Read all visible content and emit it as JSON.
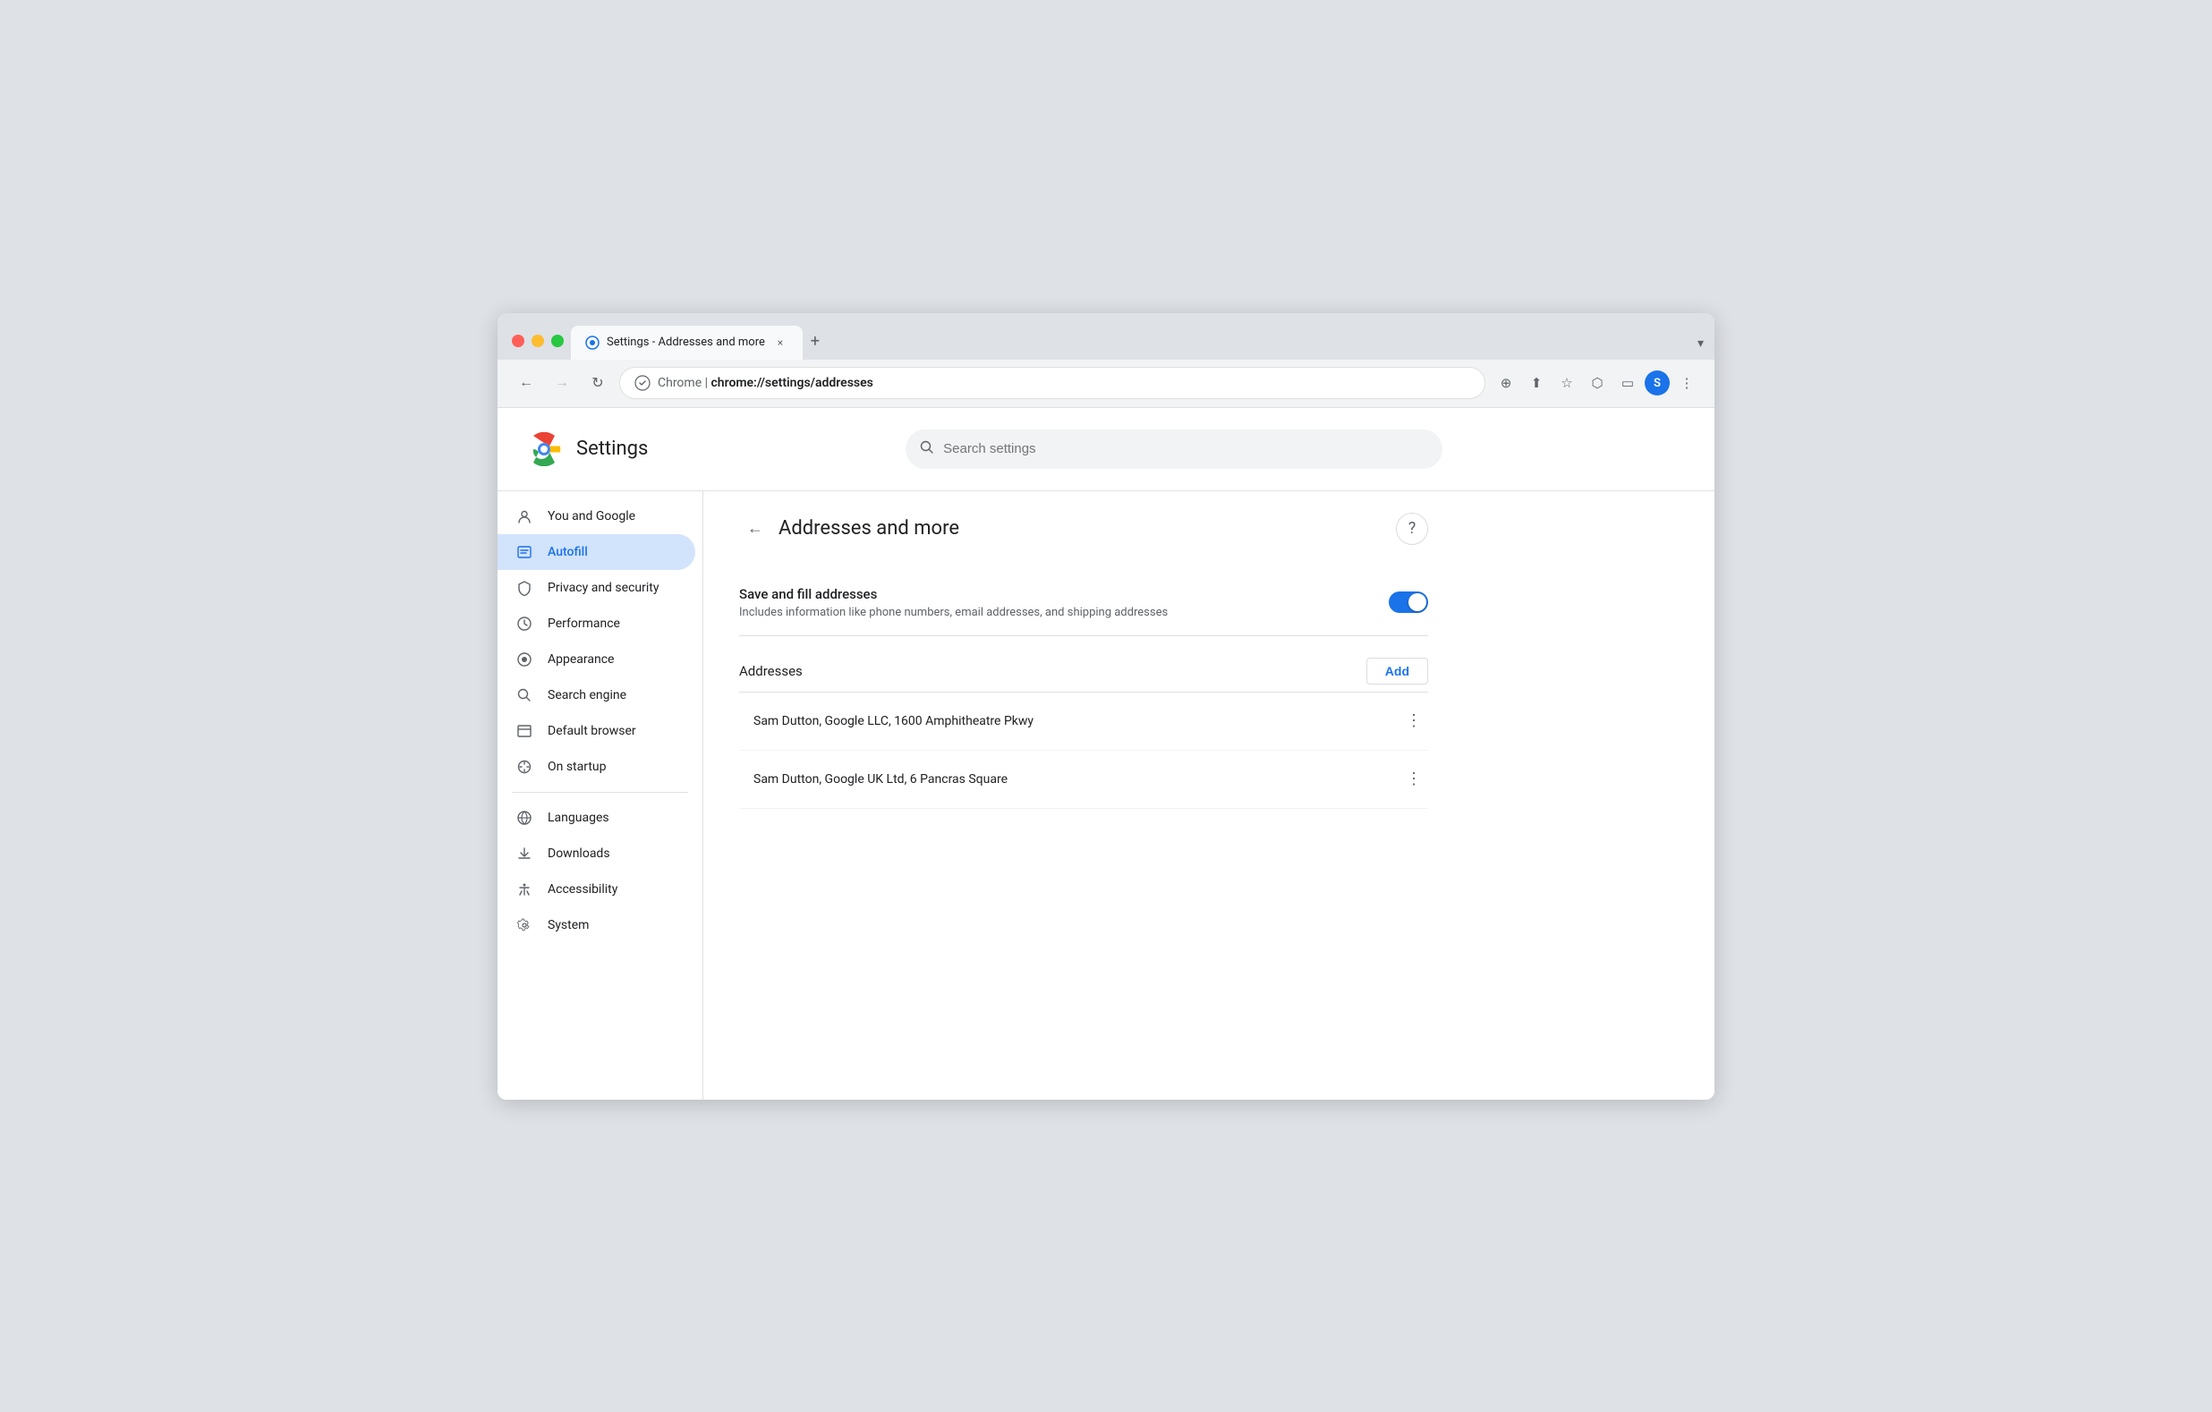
{
  "browser": {
    "tab": {
      "favicon_label": "settings-favicon",
      "title": "Settings - Addresses and more",
      "close_label": "×"
    },
    "new_tab_label": "+",
    "dropdown_label": "▾",
    "nav": {
      "back_label": "←",
      "forward_label": "→",
      "reload_label": "↻",
      "address": {
        "protocol": "Chrome  |  ",
        "path": "chrome://settings/addresses",
        "full": "chrome://settings/addresses"
      },
      "actions": {
        "zoom_label": "⊕",
        "share_label": "⬆",
        "bookmark_label": "☆",
        "extensions_label": "⬡",
        "sidebar_label": "▭",
        "profile_label": "S",
        "menu_label": "⋮"
      }
    }
  },
  "settings": {
    "logo_label": "Chrome logo",
    "title": "Settings",
    "search": {
      "placeholder": "Search settings",
      "value": ""
    }
  },
  "sidebar": {
    "items": [
      {
        "id": "you-and-google",
        "label": "You and Google",
        "icon": "👤"
      },
      {
        "id": "autofill",
        "label": "Autofill",
        "icon": "📋",
        "active": true
      },
      {
        "id": "privacy-security",
        "label": "Privacy and security",
        "icon": "🛡"
      },
      {
        "id": "performance",
        "label": "Performance",
        "icon": "⏱"
      },
      {
        "id": "appearance",
        "label": "Appearance",
        "icon": "🎨"
      },
      {
        "id": "search-engine",
        "label": "Search engine",
        "icon": "🔍"
      },
      {
        "id": "default-browser",
        "label": "Default browser",
        "icon": "⬛"
      },
      {
        "id": "on-startup",
        "label": "On startup",
        "icon": "⏻"
      }
    ],
    "items2": [
      {
        "id": "languages",
        "label": "Languages",
        "icon": "🌐"
      },
      {
        "id": "downloads",
        "label": "Downloads",
        "icon": "⬇"
      },
      {
        "id": "accessibility",
        "label": "Accessibility",
        "icon": "♿"
      },
      {
        "id": "system",
        "label": "System",
        "icon": "🔧"
      }
    ]
  },
  "panel": {
    "back_label": "←",
    "title": "Addresses and more",
    "help_label": "?",
    "save_fill": {
      "name": "Save and fill addresses",
      "desc": "Includes information like phone numbers, email addresses, and shipping addresses",
      "enabled": true
    },
    "addresses_label": "Addresses",
    "add_btn_label": "Add",
    "addresses": [
      {
        "id": "addr1",
        "text": "Sam Dutton, Google LLC, 1600 Amphitheatre Pkwy"
      },
      {
        "id": "addr2",
        "text": "Sam Dutton, Google UK Ltd, 6 Pancras Square"
      }
    ],
    "menu_icon_label": "⋮"
  }
}
